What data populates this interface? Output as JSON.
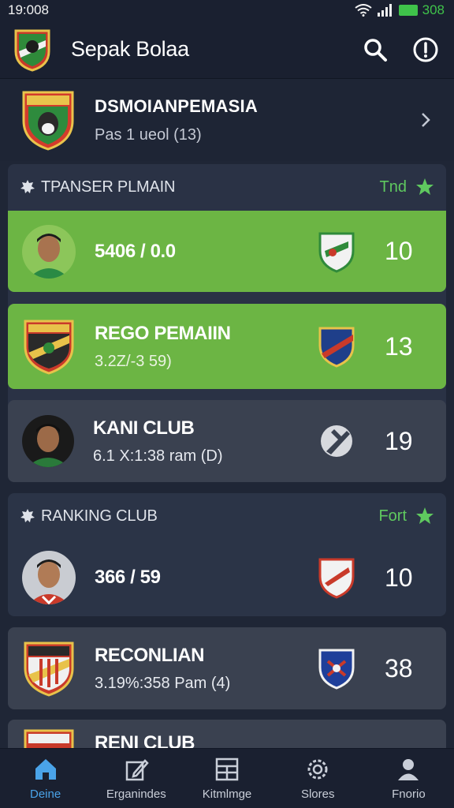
{
  "status_bar": {
    "time": "19:008",
    "battery": "308"
  },
  "app_bar": {
    "title": "Sepak Bolaa",
    "icons": [
      "search-icon",
      "info-icon"
    ]
  },
  "featured": {
    "title": "DSMOIANPEMASIA",
    "subtitle": "Pas 1 ueol (13)"
  },
  "section_transfer": {
    "title": "TPANSER PLMAIN",
    "link": "Tnd"
  },
  "transfer_cards": [
    {
      "title": "5406 / 0.0",
      "subtitle": "",
      "number": "10",
      "style": "green"
    },
    {
      "title": "REGO PEMAIIN",
      "subtitle": "3.2Z/-3 59)",
      "number": "13",
      "style": "green"
    },
    {
      "title": "KANI CLUB",
      "subtitle": "6.1 X:1:38 ram (D)",
      "number": "19",
      "style": "gray"
    }
  ],
  "section_ranking": {
    "title": "RANKING CLUB",
    "link": "Fort"
  },
  "ranking_cards": [
    {
      "title": "366 / 59",
      "subtitle": "",
      "number": "10"
    },
    {
      "title": "RECONLIAN",
      "subtitle": "3.19%:358 Pam (4)",
      "number": "38"
    },
    {
      "title": "RENI CLUB",
      "subtitle": "",
      "number": ""
    }
  ],
  "bottom_nav": [
    {
      "label": "Deine",
      "icon": "home-icon",
      "active": true
    },
    {
      "label": "Erganindes",
      "icon": "edit-icon",
      "active": false
    },
    {
      "label": "Kitmlmge",
      "icon": "grid-icon",
      "active": false
    },
    {
      "label": "Slores",
      "icon": "gear-icon",
      "active": false
    },
    {
      "label": "Fnorio",
      "icon": "person-icon",
      "active": false
    }
  ],
  "colors": {
    "accent_green": "#6cb544",
    "link_green": "#5fc95f",
    "nav_active": "#4aa3e8",
    "background": "#1f2636"
  }
}
